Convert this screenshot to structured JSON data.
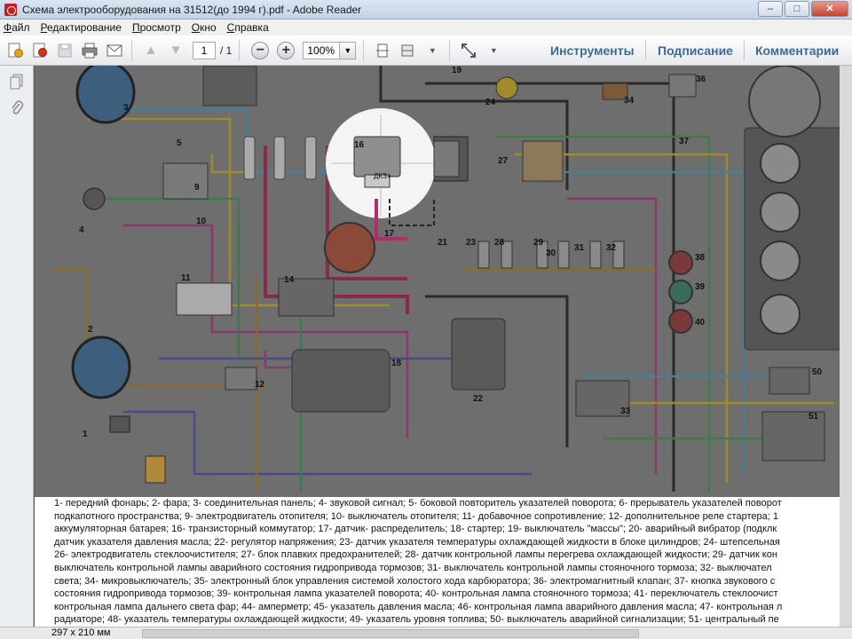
{
  "window": {
    "title": "Схема электрооборудования на 31512(до 1994 г).pdf - Adobe Reader",
    "controls": {
      "minimize": "–",
      "restore": "□",
      "close": "✕"
    }
  },
  "menu": [
    "Файл",
    "Редактирование",
    "Просмотр",
    "Окно",
    "Справка"
  ],
  "toolbar": {
    "page_current": "1",
    "page_total": "/ 1",
    "zoom_value": "100%",
    "zoom_out": "−",
    "zoom_in": "+",
    "tools_label": "Инструменты",
    "sign_label": "Подписание",
    "comment_label": "Комментарии"
  },
  "diagram": {
    "labels": [
      "1",
      "2",
      "3",
      "4",
      "5",
      "6",
      "7",
      "8",
      "9",
      "10",
      "11",
      "12",
      "13",
      "14",
      "15",
      "16",
      "17",
      "18",
      "19",
      "20",
      "21",
      "22",
      "23",
      "24",
      "25",
      "26",
      "27",
      "28",
      "29",
      "30",
      "31",
      "32",
      "33",
      "34",
      "35",
      "36",
      "37",
      "38",
      "39",
      "40",
      "50",
      "51"
    ],
    "regulator_text": "ДКЗ+"
  },
  "legend": {
    "lines": [
      "1- передний фонарь; 2- фара; 3- соединительная панель; 4- звуковой сигнал; 5- боковой повторитель указателей поворота; 6- прерыватель указателей поворот",
      "подкапотного пространства; 9- электродвигатель отопителя; 10- выключатель отопителя; 11- добавочное сопротивление; 12- дополнительное реле стартера; 1",
      "аккумуляторная батарея; 16- транзисторный коммутатор; 17- датчик- распределитель; 18- стартер; 19- выключатель \"массы\"; 20- аварийный вибратор (подклк",
      "датчик указателя давления масла; 22- регулятор напряжения; 23- датчик указателя температуры охлаждающей жидкости в блоке цилиндров; 24- штепсельная",
      "26- электродвигатель стеклоочистителя; 27- блок плавких предохранителей; 28- датчик контрольной лампы перегрева охлаждающей жидкости; 29- датчик кон",
      "выключатель контрольной лампы аварийного состояния гидропривода тормозов; 31- выключатель контрольной лампы стояночного тормоза; 32- выключател",
      "света; 34- микровыключатель; 35- электронный блок управления системой холостого хода карбюратора; 36- электромагнитный клапан; 37- кнопка звукового с",
      "состояния гидропривода тормозов; 39- контрольная лампа указателей поворота; 40- контрольная лампа стояночного тормоза; 41- переключатель стеклоочист",
      "контрольная лампа дальнего света фар; 44- амперметр; 45- указатель давления масла; 46- контрольная лампа аварийного давления масла; 47- контрольная л",
      "радиаторе; 48- указатель температуры охлаждающей жидкости; 49- указатель уровня топлива; 50- выключатель аварийной сигнализации; 51- центральный пе"
    ]
  },
  "status": {
    "page_size": "297 x 210 мм"
  },
  "colors": {
    "accent_link": "#3a6a9c",
    "diagram_bg": "#6e6e6e"
  }
}
